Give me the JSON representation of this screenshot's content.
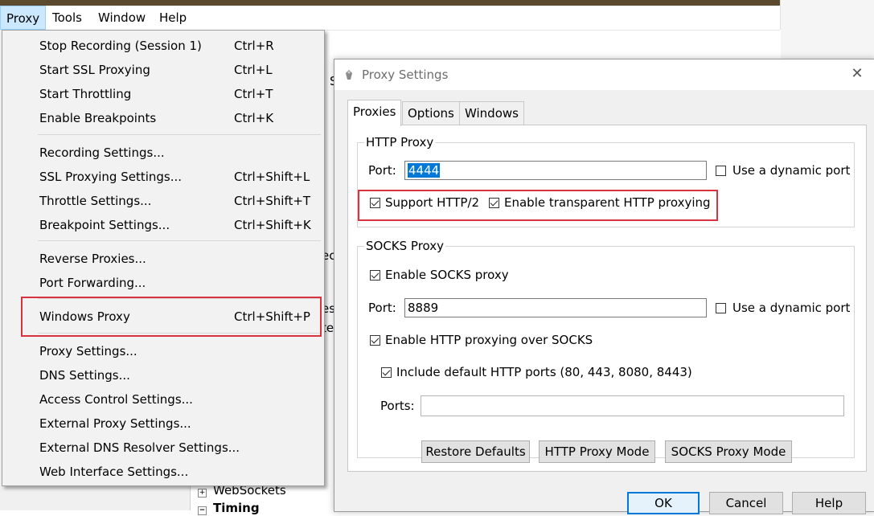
{
  "menubar": {
    "items": [
      {
        "label": "Proxy"
      },
      {
        "label": "Tools"
      },
      {
        "label": "Window"
      },
      {
        "label": "Help"
      }
    ]
  },
  "background": {
    "fragments": [
      "S",
      "ec",
      "es",
      "te"
    ],
    "tree": [
      {
        "label": "WebSockets",
        "toggle": "+"
      },
      {
        "label": "Timing",
        "toggle": "−"
      }
    ]
  },
  "proxy_menu": {
    "items": [
      {
        "label": "Stop Recording (Session 1)",
        "shortcut": "Ctrl+R"
      },
      {
        "label": "Start SSL Proxying",
        "shortcut": "Ctrl+L"
      },
      {
        "label": "Start Throttling",
        "shortcut": "Ctrl+T"
      },
      {
        "label": "Enable Breakpoints",
        "shortcut": "Ctrl+K"
      },
      {
        "label": "Recording Settings...",
        "shortcut": ""
      },
      {
        "label": "SSL Proxying Settings...",
        "shortcut": "Ctrl+Shift+L"
      },
      {
        "label": "Throttle Settings...",
        "shortcut": "Ctrl+Shift+T"
      },
      {
        "label": "Breakpoint Settings...",
        "shortcut": "Ctrl+Shift+K"
      },
      {
        "label": "Reverse Proxies...",
        "shortcut": ""
      },
      {
        "label": "Port Forwarding...",
        "shortcut": ""
      },
      {
        "label": "Windows Proxy",
        "shortcut": "Ctrl+Shift+P"
      },
      {
        "label": "Proxy Settings...",
        "shortcut": ""
      },
      {
        "label": "DNS Settings...",
        "shortcut": ""
      },
      {
        "label": "Access Control Settings...",
        "shortcut": ""
      },
      {
        "label": "External Proxy Settings...",
        "shortcut": ""
      },
      {
        "label": "External DNS Resolver Settings...",
        "shortcut": ""
      },
      {
        "label": "Web Interface Settings...",
        "shortcut": ""
      }
    ]
  },
  "dialog": {
    "title": "Proxy Settings",
    "close_glyph": "✕",
    "tabs": [
      {
        "label": "Proxies",
        "active": true
      },
      {
        "label": "Options",
        "active": false
      },
      {
        "label": "Windows",
        "active": false
      }
    ],
    "http_proxy": {
      "title": "HTTP Proxy",
      "port_label": "Port:",
      "port_value": "4444",
      "dynamic_port_label": "Use a dynamic port",
      "dynamic_port_checked": false,
      "support_http2_label": "Support HTTP/2",
      "support_http2_checked": true,
      "transparent_label": "Enable transparent HTTP proxying",
      "transparent_checked": true
    },
    "socks_proxy": {
      "title": "SOCKS Proxy",
      "enable_label": "Enable SOCKS proxy",
      "enable_checked": true,
      "port_label": "Port:",
      "port_value": "8889",
      "dynamic_port_label": "Use a dynamic port",
      "dynamic_port_checked": false,
      "http_over_socks_label": "Enable HTTP proxying over SOCKS",
      "http_over_socks_checked": true,
      "include_default_label": "Include default HTTP ports (80, 443, 8080, 8443)",
      "include_default_checked": true,
      "ports_label": "Ports:",
      "ports_value": ""
    },
    "buttons": {
      "restore_defaults": "Restore Defaults",
      "http_proxy_mode": "HTTP Proxy Mode",
      "socks_proxy_mode": "SOCKS Proxy Mode",
      "ok": "OK",
      "cancel": "Cancel",
      "help": "Help"
    }
  },
  "colors": {
    "highlight_border": "#d9333f",
    "selection": "#0078d7",
    "menu_active_bg": "#cce8ff"
  }
}
